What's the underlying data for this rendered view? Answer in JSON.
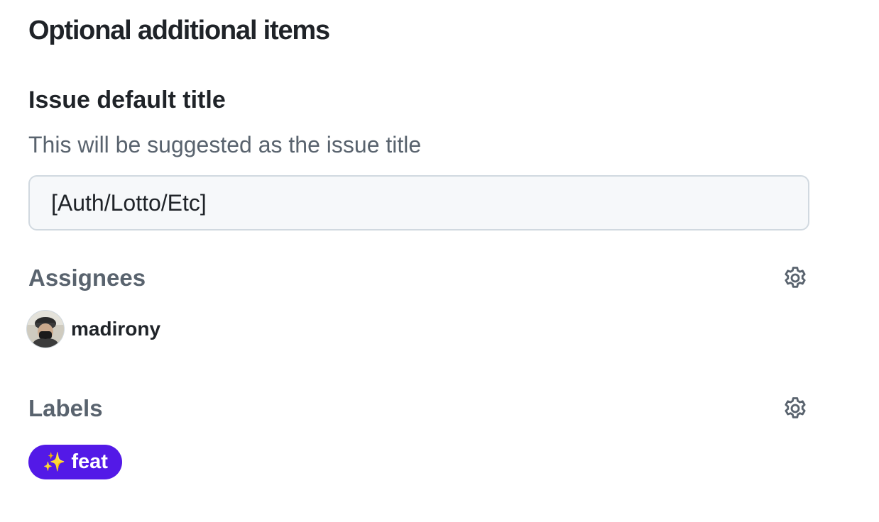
{
  "section": {
    "title": "Optional additional items"
  },
  "issue_title": {
    "heading": "Issue default title",
    "description": "This will be suggested as the issue title",
    "value": "[Auth/Lotto/Etc]"
  },
  "assignees": {
    "heading": "Assignees",
    "settings_icon": "gear-icon",
    "items": [
      {
        "username": "madirony",
        "avatar_icon": "avatar"
      }
    ]
  },
  "labels": {
    "heading": "Labels",
    "settings_icon": "gear-icon",
    "items": [
      {
        "emoji": "✨",
        "name": "feat",
        "color": "#5319e7",
        "text_color": "#ffffff"
      }
    ]
  },
  "colors": {
    "text_primary": "#1f2328",
    "text_muted": "#59636e",
    "input_bg": "#f6f8fa",
    "input_border": "#d1d9e0"
  }
}
